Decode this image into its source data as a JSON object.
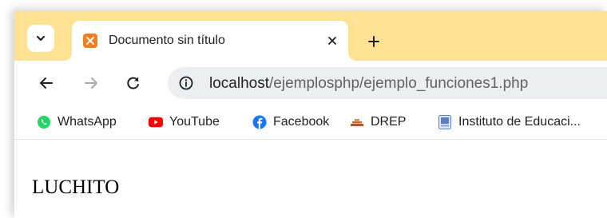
{
  "tab": {
    "title": "Documento sin título"
  },
  "toolbar": {
    "url_host": "localhost",
    "url_path": "/ejemplosphp/ejemplo_funciones1.php"
  },
  "bookmarks": [
    {
      "label": "WhatsApp",
      "icon": "whatsapp-icon",
      "color": "#25d366"
    },
    {
      "label": "YouTube",
      "icon": "youtube-icon",
      "color": "#ff0000"
    },
    {
      "label": "Facebook",
      "icon": "facebook-icon",
      "color": "#1877f2"
    },
    {
      "label": "DREP",
      "icon": "drep-icon",
      "color": "#b5542a"
    },
    {
      "label": "Instituto de Educaci...",
      "icon": "institute-icon",
      "color": "#5b7fc1"
    }
  ],
  "page": {
    "content": "LUCHITO"
  },
  "colors": {
    "tabstrip": "#fde293",
    "omnibox": "#eceef1",
    "favicon": "#f57c1f"
  }
}
